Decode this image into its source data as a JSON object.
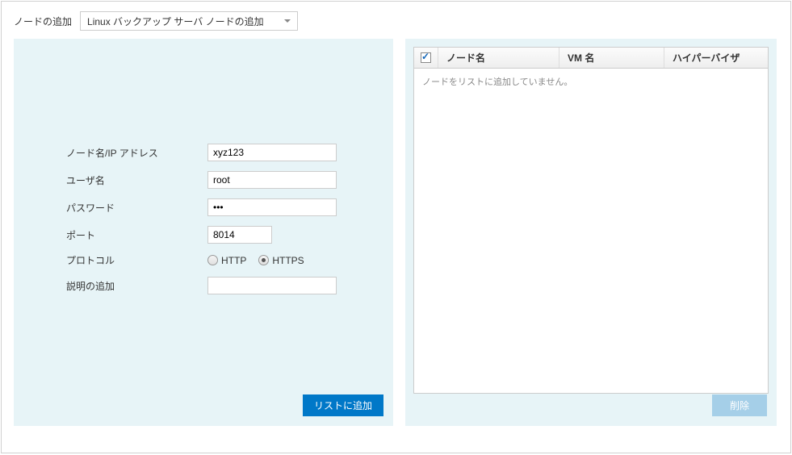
{
  "topbar": {
    "label": "ノードの追加",
    "dropdown_value": "Linux バックアップ サーバ ノードの追加"
  },
  "form": {
    "node_ip_label": "ノード名/IP アドレス",
    "node_ip_value": "xyz123",
    "username_label": "ユーザ名",
    "username_value": "root",
    "password_label": "パスワード",
    "password_value": "•••",
    "port_label": "ポート",
    "port_value": "8014",
    "protocol_label": "プロトコル",
    "protocol_http": "HTTP",
    "protocol_https": "HTTPS",
    "description_label": "説明の追加",
    "description_value": ""
  },
  "buttons": {
    "add_to_list": "リストに追加",
    "delete": "削除"
  },
  "table": {
    "col_node": "ノード名",
    "col_vm": "VM 名",
    "col_hypervisor": "ハイパーバイザ",
    "empty_message": "ノードをリストに追加していません。"
  }
}
